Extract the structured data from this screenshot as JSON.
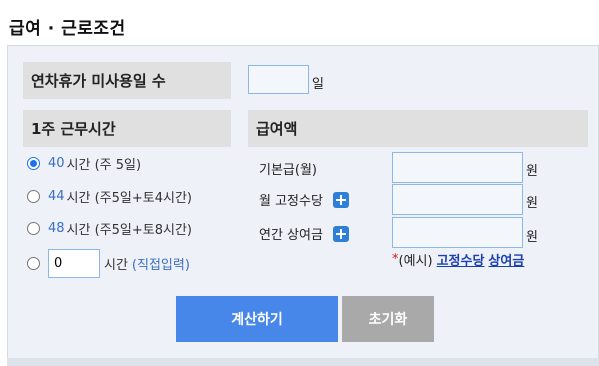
{
  "header": {
    "title": "급여 · 근로조건"
  },
  "unused_leave": {
    "label": "연차휴가 미사용일 수",
    "value": "",
    "unit": "일"
  },
  "work_hours": {
    "label": "1주 근무시간",
    "options": [
      {
        "hours": "40",
        "text": "시간 (주 5일)",
        "selected": true
      },
      {
        "hours": "44",
        "text": "시간 (주5일+토4시간)",
        "selected": false
      },
      {
        "hours": "48",
        "text": "시간 (주5일+토8시간)",
        "selected": false
      }
    ],
    "custom": {
      "value": "0",
      "unit": "시간",
      "link": "(직접입력)"
    }
  },
  "pay": {
    "label": "급여액",
    "rows": [
      {
        "label": "기본급(월)",
        "value": "",
        "unit": "원",
        "has_plus": false
      },
      {
        "label": "월 고정수당",
        "value": "",
        "unit": "원",
        "has_plus": true
      },
      {
        "label": "연간 상여금",
        "value": "",
        "unit": "원",
        "has_plus": true
      }
    ],
    "example": {
      "asterisk": "*",
      "prefix": "(예시)",
      "link1": "고정수당",
      "link2": "상여금"
    }
  },
  "buttons": {
    "calculate": "계산하기",
    "reset": "초기화"
  },
  "colors": {
    "primary": "#4687e9",
    "reset": "#a9a9a9",
    "panel": "#eef1f8",
    "link": "#1a3fb0"
  }
}
